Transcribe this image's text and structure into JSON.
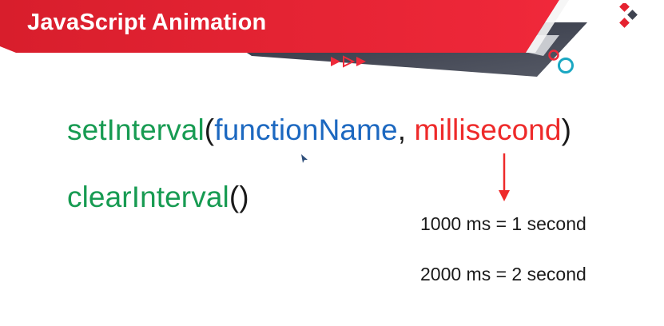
{
  "header": {
    "title": "JavaScript Animation"
  },
  "code": {
    "set_interval": {
      "fn_name": "setInterval",
      "open_paren": "(",
      "arg1": "functionName",
      "comma": ",",
      "arg2": "millisecond",
      "close_paren": ")"
    },
    "clear_interval": {
      "fn_name": "clearInterval",
      "parens": "()"
    }
  },
  "notes": {
    "line1": "1000 ms = 1 second",
    "line2": "2000 ms = 2 second"
  },
  "colors": {
    "banner_red": "#e52230",
    "banner_dark": "#3f4350",
    "function_green": "#179b52",
    "argument_blue": "#1c68c0",
    "argument_red": "#ee2a2a"
  },
  "icons": [
    "play-arrows-icon",
    "circles-icon",
    "diamond-logo-icon",
    "down-arrow-icon",
    "mouse-cursor-icon"
  ]
}
